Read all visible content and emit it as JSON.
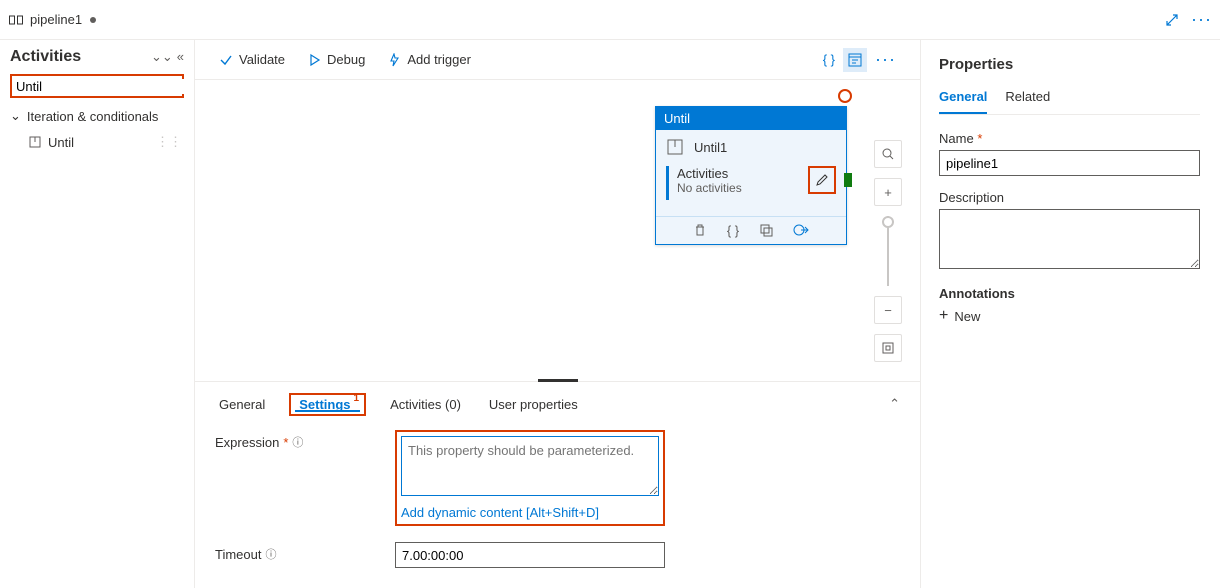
{
  "topbar": {
    "pipeline_tab": "pipeline1",
    "dirty": true
  },
  "sidebar": {
    "title": "Activities",
    "search_value": "Until",
    "category": "Iteration & conditionals",
    "items": [
      {
        "label": "Until"
      }
    ]
  },
  "toolbar": {
    "validate": "Validate",
    "debug": "Debug",
    "add_trigger": "Add trigger"
  },
  "canvas": {
    "node": {
      "type_label": "Until",
      "name": "Until1",
      "activities_label": "Activities",
      "activities_sub": "No activities"
    }
  },
  "bottom_tabs": {
    "general": "General",
    "settings": "Settings",
    "settings_badge": "1",
    "activities": "Activities (0)",
    "user_props": "User properties"
  },
  "settings": {
    "expression_label": "Expression",
    "expression_placeholder": "This property should be parameterized.",
    "dyn_link": "Add dynamic content [Alt+Shift+D]",
    "timeout_label": "Timeout",
    "timeout_value": "7.00:00:00"
  },
  "properties": {
    "title": "Properties",
    "tab_general": "General",
    "tab_related": "Related",
    "name_label": "Name",
    "name_value": "pipeline1",
    "description_label": "Description",
    "description_value": "",
    "annotations_label": "Annotations",
    "new_label": "New"
  }
}
